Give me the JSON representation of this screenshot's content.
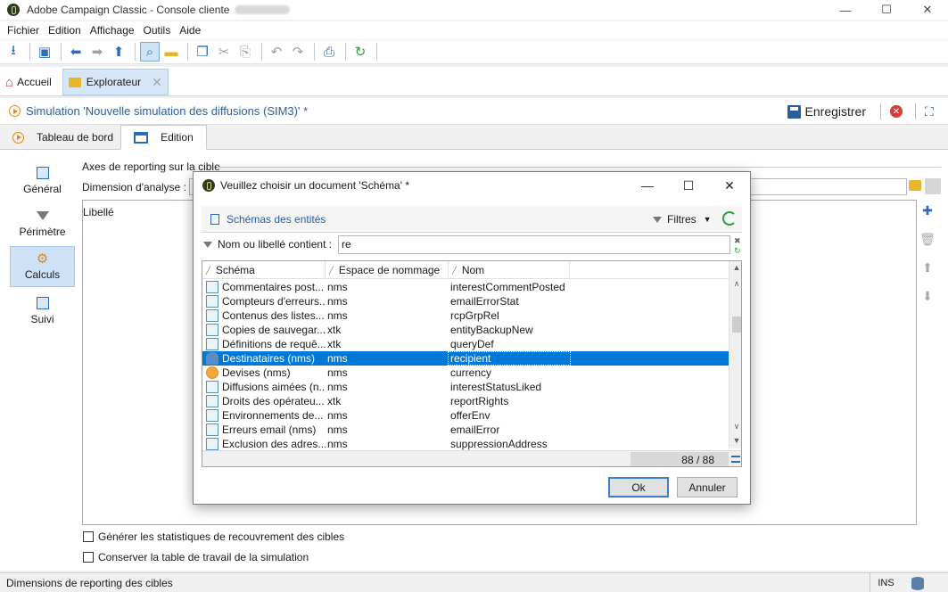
{
  "window": {
    "title": "Adobe Campaign Classic - Console cliente",
    "controls": [
      "—",
      "☐",
      "✕"
    ]
  },
  "menubar": [
    "Fichier",
    "Edition",
    "Affichage",
    "Outils",
    "Aide"
  ],
  "toolbar_icons": [
    "new-icon",
    "explorer-icon",
    "back-icon",
    "forward-icon",
    "up-icon",
    "search-icon",
    "folder-icon",
    "copy-icon",
    "cut-icon",
    "paste-icon",
    "undo-icon",
    "redo-icon",
    "print-icon",
    "refresh-icon"
  ],
  "nav_tabs": [
    {
      "label": "Accueil"
    },
    {
      "label": "Explorateur",
      "close": "✕"
    }
  ],
  "simulation": {
    "title": "Simulation 'Nouvelle simulation des diffusions (SIM3)' *",
    "save_label": "Enregistrer"
  },
  "sub_tabs": [
    {
      "label": "Tableau de bord"
    },
    {
      "label": "Edition"
    }
  ],
  "left_nav": [
    {
      "label": "Général"
    },
    {
      "label": "Périmètre"
    },
    {
      "label": "Calculs"
    },
    {
      "label": "Suivi"
    }
  ],
  "form": {
    "axes_label": "Axes de reporting sur la cible",
    "dimension_label": "Dimension d'analyse :",
    "list_header": "Libellé",
    "checkbox1": "Générer les statistiques de recouvrement des cibles",
    "checkbox2": "Conserver la table de travail de la simulation"
  },
  "status": {
    "text": "Dimensions de reporting des cibles",
    "mode": "INS"
  },
  "dialog": {
    "title": "Veuillez choisir un document 'Schéma' *",
    "entity_link": "Schémas des entités",
    "filters_label": "Filtres",
    "search_label": "Nom ou libellé contient :",
    "search_value": "re",
    "columns": [
      "Schéma",
      "Espace de nommage",
      "Nom"
    ],
    "rows": [
      {
        "schema": "Commentaires post...",
        "ns": "nms",
        "name": "interestCommentPosted",
        "icon": "doc"
      },
      {
        "schema": "Compteurs d'erreurs...",
        "ns": "nms",
        "name": "emailErrorStat",
        "icon": "doc"
      },
      {
        "schema": "Contenus des listes...",
        "ns": "nms",
        "name": "rcpGrpRel",
        "icon": "doc"
      },
      {
        "schema": "Copies de sauvegar...",
        "ns": "xtk",
        "name": "entityBackupNew",
        "icon": "doc"
      },
      {
        "schema": "Définitions de requê...",
        "ns": "xtk",
        "name": "queryDef",
        "icon": "doc"
      },
      {
        "schema": "Destinataires (nms)",
        "ns": "nms",
        "name": "recipient",
        "icon": "person",
        "selected": true
      },
      {
        "schema": "Devises (nms)",
        "ns": "nms",
        "name": "currency",
        "icon": "coin"
      },
      {
        "schema": "Diffusions aimées (n...",
        "ns": "nms",
        "name": "interestStatusLiked",
        "icon": "doc"
      },
      {
        "schema": "Droits des opérateu...",
        "ns": "xtk",
        "name": "reportRights",
        "icon": "doc"
      },
      {
        "schema": "Environnements de...",
        "ns": "nms",
        "name": "offerEnv",
        "icon": "doc"
      },
      {
        "schema": "Erreurs email (nms)",
        "ns": "nms",
        "name": "emailError",
        "icon": "doc"
      },
      {
        "schema": "Exclusion des adres...",
        "ns": "nms",
        "name": "suppressionAddress",
        "icon": "doc"
      }
    ],
    "count": "88 / 88",
    "ok_label": "Ok",
    "cancel_label": "Annuler"
  }
}
